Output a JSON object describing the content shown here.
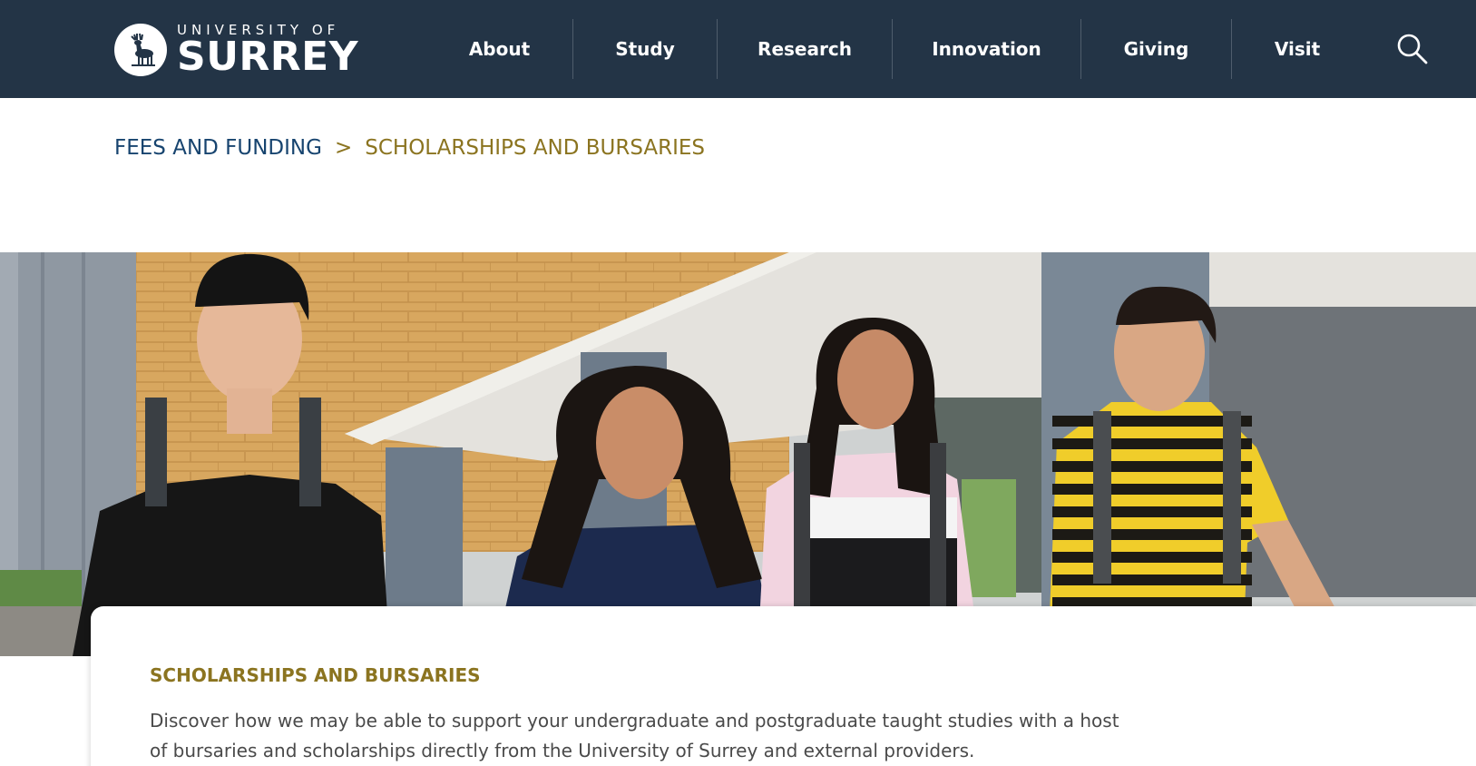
{
  "header": {
    "logo": {
      "line1": "UNIVERSITY OF",
      "line2": "SURREY",
      "icon": "stag-emblem-icon"
    },
    "nav": [
      {
        "label": "About"
      },
      {
        "label": "Study"
      },
      {
        "label": "Research"
      },
      {
        "label": "Innovation"
      },
      {
        "label": "Giving"
      },
      {
        "label": "Visit"
      }
    ],
    "search_icon": "search-icon"
  },
  "breadcrumb": {
    "parent": "FEES AND FUNDING",
    "separator": ">",
    "current": "SCHOLARSHIPS AND BURSARIES"
  },
  "content": {
    "heading": "SCHOLARSHIPS AND BURSARIES",
    "intro": "Discover how we may be able to support your undergraduate and postgraduate taught studies with a host of bursaries and scholarships directly from the University of Surrey and external providers."
  },
  "colors": {
    "header_bg": "#233446",
    "breadcrumb_link": "#17446f",
    "accent_gold": "#8b7420",
    "body_text": "#4a4a4a"
  }
}
